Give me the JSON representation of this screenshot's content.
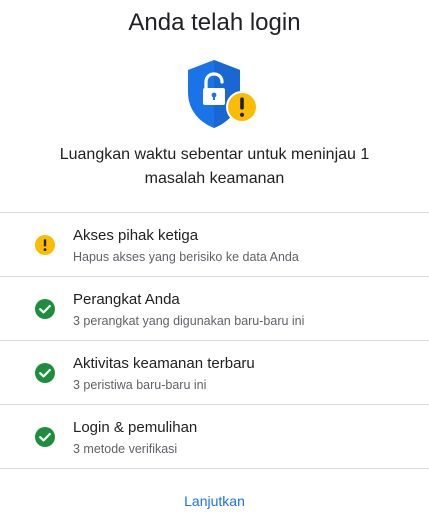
{
  "header": {
    "title": "Anda telah login"
  },
  "icon": {
    "name": "shield-unlock-warning-icon",
    "shield_color": "#1a73e8",
    "shield_shade_color": "#1967d2",
    "warning_color": "#fbbc04"
  },
  "subtitle": {
    "text": "Luangkan waktu sebentar untuk meninjau 1 masalah keamanan"
  },
  "items": [
    {
      "title": "Akses pihak ketiga",
      "description": "Hapus akses yang berisiko ke data Anda",
      "status": "warning",
      "icon": "warning-icon",
      "color": "#fbbc04"
    },
    {
      "title": "Perangkat Anda",
      "description": "3 perangkat yang digunakan baru-baru ini",
      "status": "ok",
      "icon": "check-circle-icon",
      "color": "#1e8e3e"
    },
    {
      "title": "Aktivitas keamanan terbaru",
      "description": "3 peristiwa baru-baru ini",
      "status": "ok",
      "icon": "check-circle-icon",
      "color": "#1e8e3e"
    },
    {
      "title": "Login & pemulihan",
      "description": "3 metode verifikasi",
      "status": "ok",
      "icon": "check-circle-icon",
      "color": "#1e8e3e"
    }
  ],
  "footer": {
    "continue_label": "Lanjutkan",
    "link_color": "#1a73e8"
  }
}
